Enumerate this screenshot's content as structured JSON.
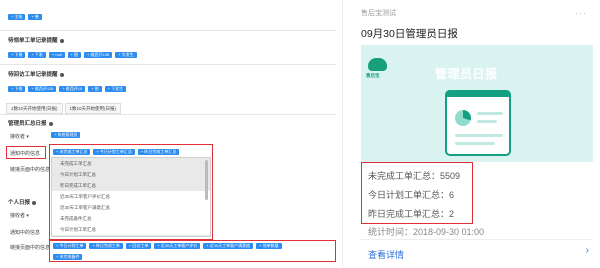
{
  "left": {
    "row1_tags": [
      "+ 主账",
      "+ 善"
    ],
    "section1": {
      "title": "待领单工单记录提醒",
      "tags": [
        "+ 下拨",
        "+ 下发",
        "+ null",
        "+ 图",
        "+ 维西开106",
        "+ 文发生"
      ]
    },
    "section2": {
      "title": "待回访工单记录提醒",
      "tags": [
        "+ 下拨",
        "+ 维西开115",
        "+ 维西开10",
        "+ 图",
        "+ 下发生"
      ]
    },
    "tabs": [
      "1数10天开始使用(日报)",
      "1数10天开始使用(日报)"
    ],
    "daily": {
      "title": "管理员汇总日报",
      "receiver_label": "接收者 ▾",
      "receiver_tag": "+ 系统管理员",
      "notify_label": "通知中的信息",
      "notify_tags": [
        "+ 未完成工单汇总",
        "+ 今日计划工单汇总",
        "+ 昨日完成工单汇总"
      ],
      "link_label": "链接页面中的信息",
      "dropdown_options": [
        "未完成工单汇总",
        "今日计划工单汇总",
        "昨日完成工单汇总",
        "近30天工单客户评价汇总",
        "近30天工单客户满意汇总",
        "未完成备件汇总",
        "今日计划工单汇总"
      ]
    },
    "personal": {
      "title": "个人日报",
      "receiver_label": "接收者 ▾",
      "notify_label": "通知中的信息",
      "link_label": "链接页面中的信息",
      "link_tags": [
        "+ 今日计划工单",
        "+ 昨日完成工单",
        "+ 回访工单",
        "+ 近30天工单客户评价",
        "+ 近30天工单客户满意度",
        "+ 领单数量"
      ],
      "link_tag_extra": "+ 未完成备件"
    }
  },
  "card": {
    "app_name": "售后宝测试",
    "dots": "···",
    "title": "09月30日管理员日报",
    "banner_title": "管理员日报",
    "logo_text": "售后宝",
    "stats": [
      "未完成工单汇总：5509",
      "今日计划工单汇总：6",
      "昨日完成工单汇总：2"
    ],
    "time": "统计时间：2018-09-30 01:00",
    "detail": "查看详情",
    "chevron": "›"
  },
  "colors": {
    "tag_blue": "#2d8cf0",
    "highlight_red": "#e0313a",
    "banner_bg": "#d9f3f0",
    "brand_green": "#16a083",
    "link_blue": "#2d6fd6"
  }
}
